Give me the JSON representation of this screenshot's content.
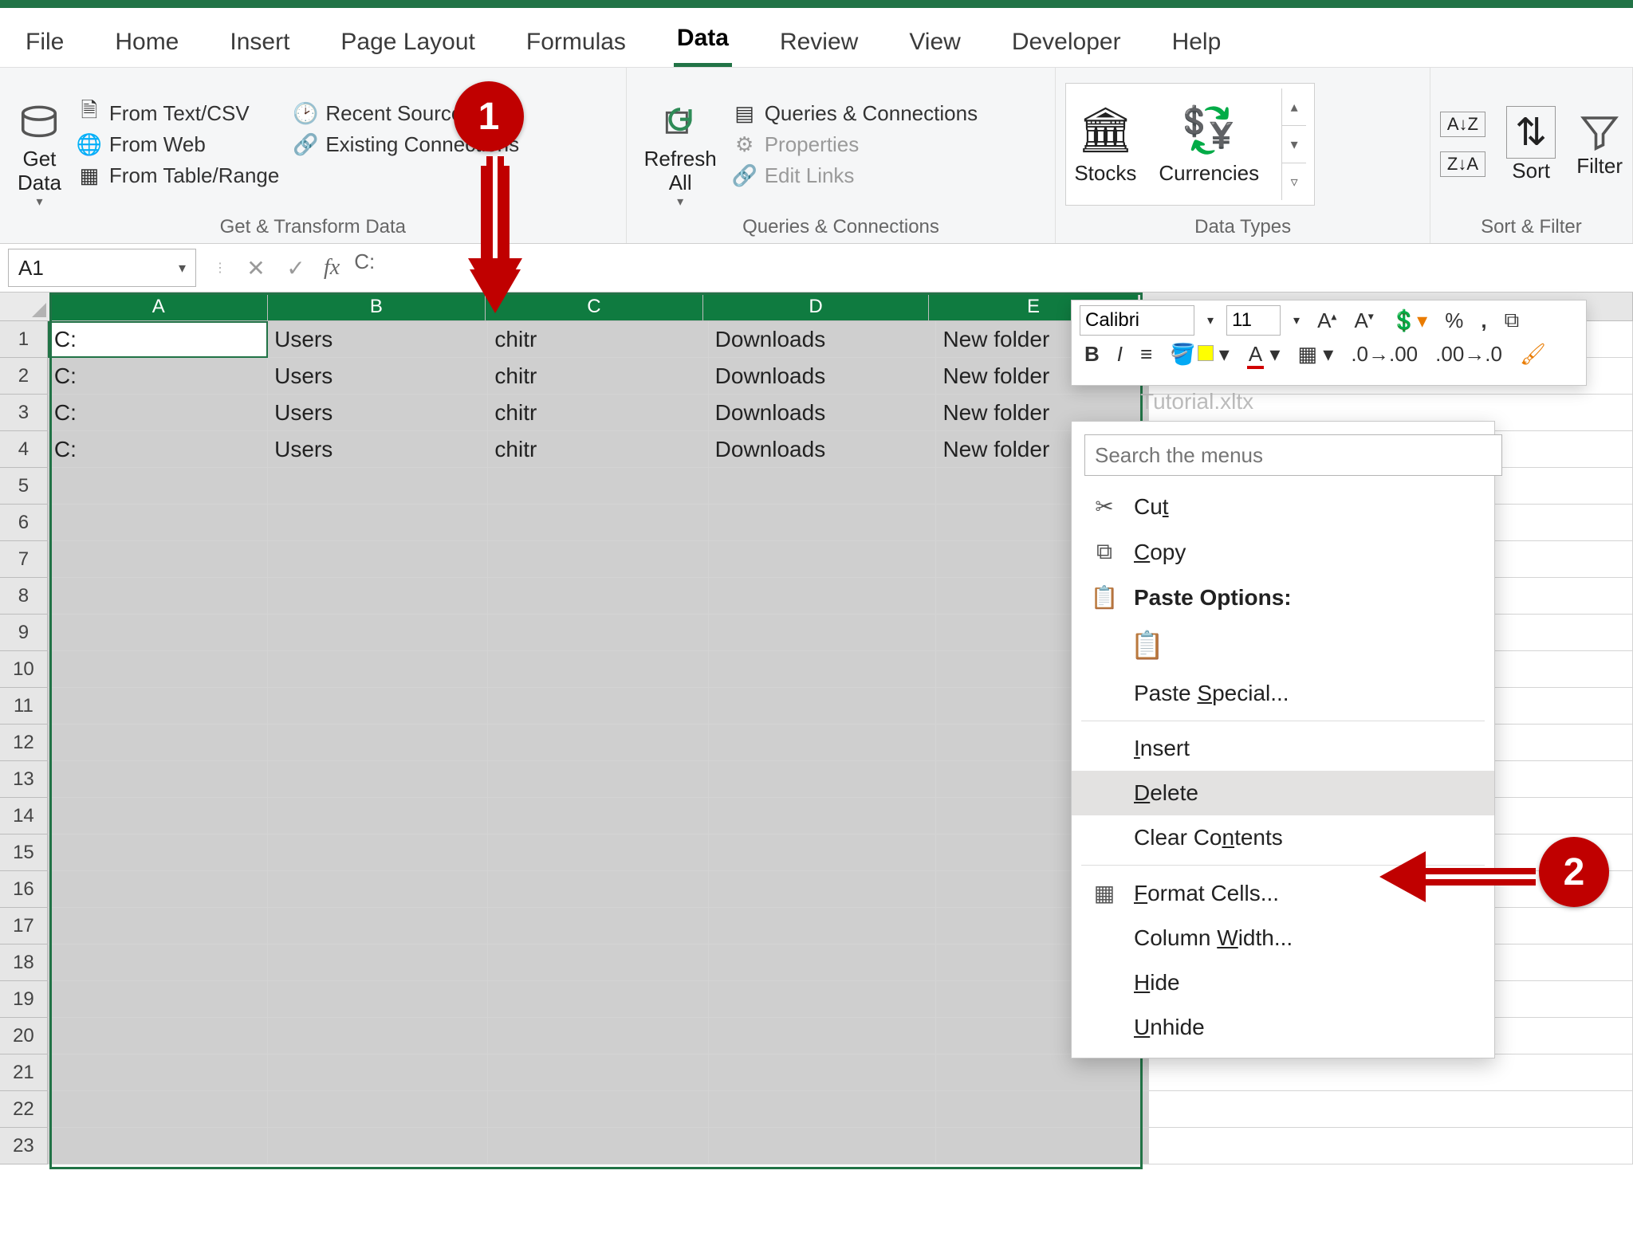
{
  "ribbon": {
    "tabs": [
      "File",
      "Home",
      "Insert",
      "Page Layout",
      "Formulas",
      "Data",
      "Review",
      "View",
      "Developer",
      "Help"
    ],
    "active_tab": "Data",
    "groups": {
      "get_transform": {
        "label": "Get & Transform Data",
        "get_data": "Get\nData",
        "from_text_csv": "From Text/CSV",
        "from_web": "From Web",
        "from_table_range": "From Table/Range",
        "recent_sources": "Recent Sources",
        "existing_connections": "Existing Connections"
      },
      "queries": {
        "label": "Queries & Connections",
        "refresh_all": "Refresh\nAll",
        "queries_conn": "Queries & Connections",
        "properties": "Properties",
        "edit_links": "Edit Links"
      },
      "data_types": {
        "label": "Data Types",
        "stocks": "Stocks",
        "currencies": "Currencies"
      },
      "sort_filter": {
        "label": "Sort & Filter",
        "az": "A→Z",
        "za": "Z→A",
        "sort": "Sort",
        "filter": "Filter"
      }
    }
  },
  "formula_bar": {
    "name_box": "A1",
    "formula": "C:"
  },
  "grid": {
    "columns": [
      "A",
      "B",
      "C",
      "D",
      "E"
    ],
    "row_count": 23,
    "data_rows": [
      {
        "A": "C:",
        "B": "Users",
        "C": "chitr",
        "D": "Downloads",
        "E": "New folder"
      },
      {
        "A": "C:",
        "B": "Users",
        "C": "chitr",
        "D": "Downloads",
        "E": "New folder"
      },
      {
        "A": "C:",
        "B": "Users",
        "C": "chitr",
        "D": "Downloads",
        "E": "New folder"
      },
      {
        "A": "C:",
        "B": "Users",
        "C": "chitr",
        "D": "Downloads",
        "E": "New folder"
      }
    ],
    "selection": "A1:E23",
    "active_cell": "A1",
    "ghost_text": "Tutorial.xltx"
  },
  "mini_toolbar": {
    "font_name": "Calibri",
    "font_size": "11"
  },
  "context_menu": {
    "search_placeholder": "Search the menus",
    "items": {
      "cut": "Cut",
      "copy": "Copy",
      "paste_options": "Paste Options:",
      "paste_special": "Paste Special...",
      "insert": "Insert",
      "delete": "Delete",
      "clear_contents": "Clear Contents",
      "format_cells": "Format Cells...",
      "column_width": "Column Width...",
      "hide": "Hide",
      "unhide": "Unhide"
    },
    "highlighted": "delete"
  },
  "callouts": {
    "step1": "1",
    "step2": "2"
  }
}
